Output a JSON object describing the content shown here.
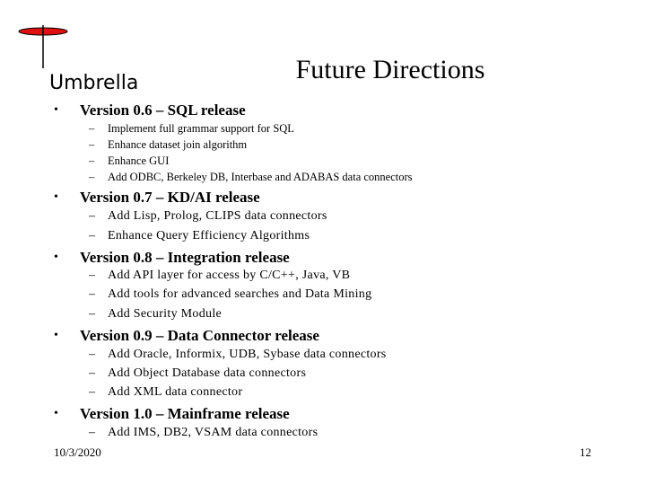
{
  "logo": {
    "text": "Umbrella",
    "icon": "umbrella-icon",
    "accent_color": "#e01010"
  },
  "title": "Future Directions",
  "sections": [
    {
      "heading": "Version 0.6 – SQL release",
      "items": [
        "Implement full grammar support for SQL",
        "Enhance dataset join algorithm",
        "Enhance GUI",
        "Add ODBC, Berkeley DB, Interbase and ADABAS data connectors"
      ]
    },
    {
      "heading": "Version 0.7 – KD/AI release",
      "items": [
        "Add Lisp, Prolog, CLIPS data connectors",
        "Enhance Query Efficiency Algorithms"
      ]
    },
    {
      "heading": "Version 0.8 – Integration release",
      "items": [
        "Add API layer for access by C/C++, Java, VB",
        "Add tools for advanced searches and Data Mining",
        "Add Security Module"
      ]
    },
    {
      "heading": "Version 0.9 – Data Connector release",
      "items": [
        "Add Oracle, Informix, UDB, Sybase data connectors",
        "Add Object Database data connectors",
        "Add XML data connector"
      ]
    },
    {
      "heading": "Version 1.0 – Mainframe release",
      "items": [
        "Add IMS, DB2, VSAM data connectors"
      ]
    }
  ],
  "bullet_glyph": "•",
  "dash_glyph": "–",
  "footer": {
    "date": "10/3/2020",
    "page_number": "12"
  }
}
